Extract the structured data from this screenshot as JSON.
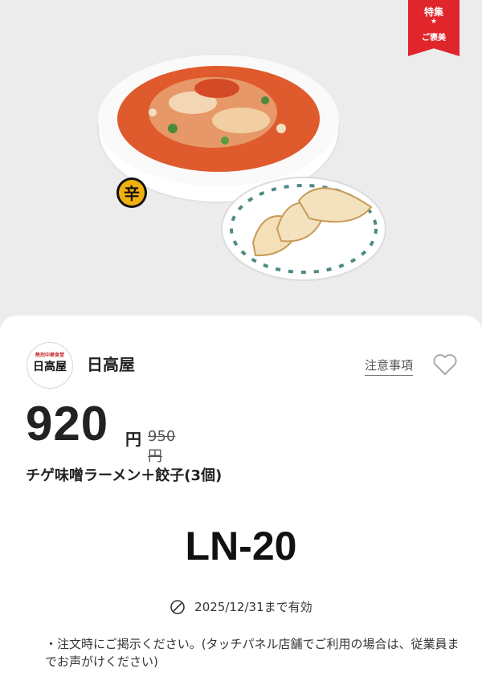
{
  "ribbon": {
    "line1": "特集",
    "star": "★",
    "line2": "ご褒美"
  },
  "hero": {
    "spicy_badge": "辛"
  },
  "shop": {
    "logo_small": "熱烈中華食堂",
    "logo_main": "日高屋",
    "name": "日高屋"
  },
  "notes_link": "注意事項",
  "price": {
    "value": "920",
    "yen": "円",
    "original": "950円"
  },
  "product": "チゲ味噌ラーメン＋餃子(3個)",
  "coupon_code": "LN-20",
  "validity": "2025/12/31まで有効",
  "instructions": "・注文時にご掲示ください。(タッチパネル店舗でご利用の場合は、従業員までお声がけください)",
  "colors": {
    "ribbon": "#e0262a",
    "soup": "#e0552a",
    "badge": "#f1b00f"
  },
  "icons": {
    "favorite": "heart-outline-icon",
    "validity": "clock-icon"
  }
}
